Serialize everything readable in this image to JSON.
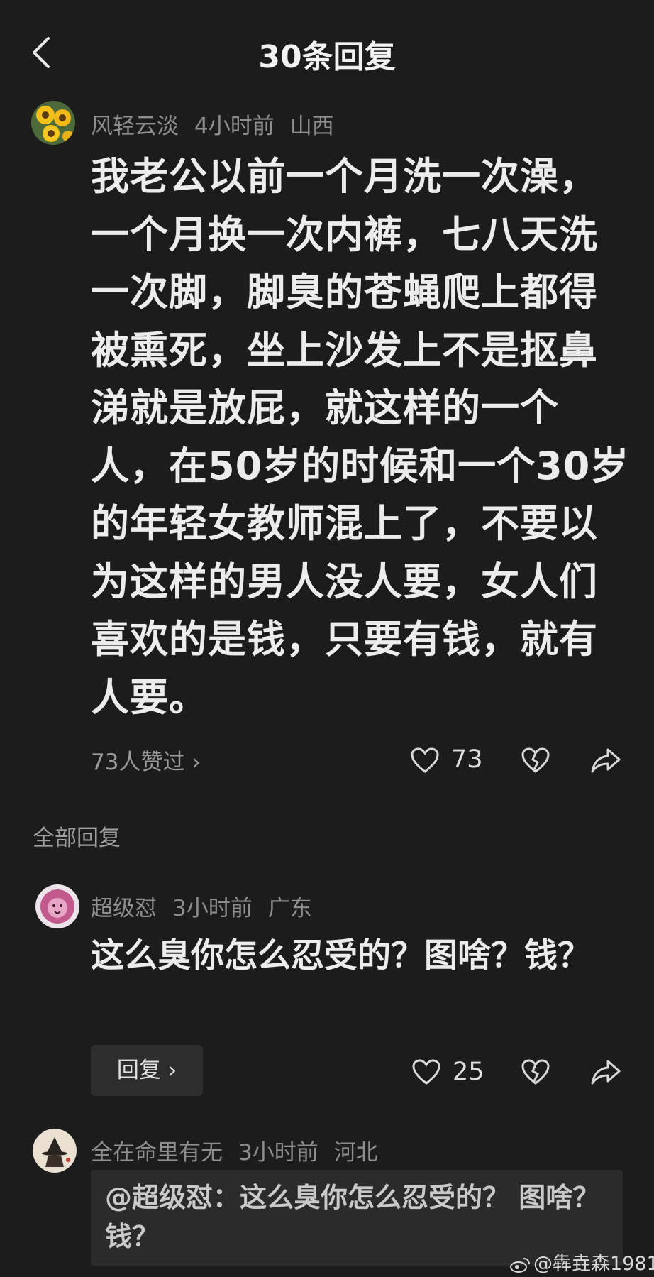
{
  "header": {
    "title": "30条回复",
    "back_icon": "chevron-left-icon"
  },
  "comment": {
    "username": "风轻云淡",
    "time": "4小时前",
    "location": "山西",
    "text": "我老公以前一个月洗一次澡，一个月换一次内裤，七八天洗一次脚，脚臭的苍蝇爬上都得被熏死，坐上沙发上不是抠鼻涕就是放屁，就这样的一个人，在50岁的时候和一个30岁的年轻女教师混上了，不要以为这样的男人没人要，女人们喜欢的是钱，只要有钱，就有人要。",
    "likes_summary": "73人赞过",
    "like_count": "73"
  },
  "section_label": "全部回复",
  "reply1": {
    "username": "超级怼",
    "time": "3小时前",
    "location": "广东",
    "text": "这么臭你怎么忍受的？图啥？钱？",
    "reply_button": "回复",
    "like_count": "25"
  },
  "reply2": {
    "username": "全在命里有无",
    "time": "3小时前",
    "location": "河北",
    "quote": "@超级怼：这么臭你怎么忍受的？ 图啥？钱？"
  },
  "watermark": "@犇垚森1981",
  "colors": {
    "background": "#1c1c1c",
    "text": "#ececec",
    "meta": "#8d8d8d",
    "surface": "#2d2d2d"
  }
}
